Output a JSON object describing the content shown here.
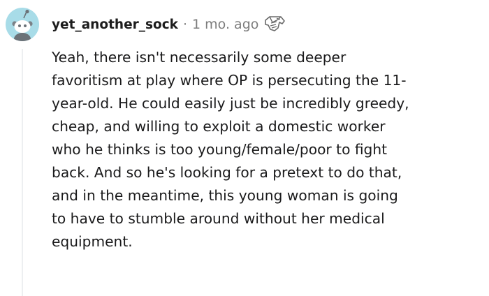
{
  "comment": {
    "username": "yet_another_sock",
    "separator": "·",
    "timestamp": "1 mo. ago",
    "avatar_icon": "snoo-avatar-icon",
    "award_icon": "award-icon",
    "body_lines": [
      "Yeah, there isn't necessarily some deeper",
      "favoritism at play where OP is persecuting the 11-",
      "year-old. He could easily just be incredibly greedy,",
      "cheap, and willing to exploit a domestic worker",
      "who he thinks is too young/female/poor to fight",
      "back. And so he's looking for a pretext to do that,",
      "and in the meantime, this young woman is going",
      "to have to stumble around without her medical",
      "equipment."
    ]
  },
  "colors": {
    "avatar_bg": "#a8dce8",
    "thread_line": "#edeff1",
    "meta_gray": "#7c7c7c",
    "text": "#1a1a1b"
  }
}
